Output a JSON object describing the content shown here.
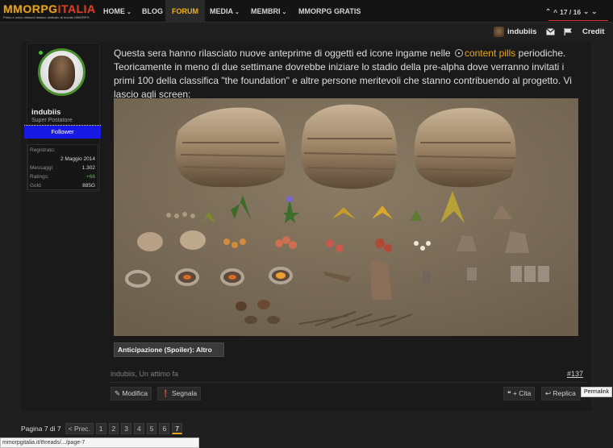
{
  "site": {
    "logo_main": "MMORPG",
    "logo_accent": "ITALIA",
    "logo_tagline": "Primo e unico network italiano dedicato al mondo MMORPG",
    "nav": [
      {
        "label": "HOME",
        "has_menu": true,
        "active": false
      },
      {
        "label": "BLOG",
        "has_menu": false,
        "active": false
      },
      {
        "label": "FORUM",
        "has_menu": false,
        "active": true
      },
      {
        "label": "MEDIA",
        "has_menu": true,
        "active": false
      },
      {
        "label": "MEMBRI",
        "has_menu": true,
        "active": false
      },
      {
        "label": "MMORPG GRATIS",
        "has_menu": false,
        "active": false
      }
    ],
    "thread_position": "17 / 16"
  },
  "userbar": {
    "username": "indubiis",
    "credit_label": "Credit",
    "icons": [
      "envelope-icon",
      "flag-icon"
    ]
  },
  "author": {
    "name": "indubiis",
    "title": "Super Postatore",
    "badge": "Follower",
    "stats": [
      {
        "label": "Registrato:",
        "value": ""
      },
      {
        "label": "",
        "value": "2 Maggio 2014"
      },
      {
        "label": "Messaggi:",
        "value": "1.302"
      },
      {
        "label": "Ratings:",
        "value": "+66"
      },
      {
        "label": "Gold",
        "value": "885G"
      }
    ],
    "ratings_color": "#4fc33a"
  },
  "post": {
    "text_before_link": "Questa sera hanno rilasciato nuove anteprime di oggetti ed icone ingame nelle ",
    "link_text": "content pills",
    "text_after_link": " periodiche. Teoricamente in meno di due settimane dovrebbe iniziare lo stadio della pre-alpha dove verranno invitati i primi 100 della classifica \"the foundation\" e altre persone meritevoli che stanno contribuendo al progetto. Vi lascio agli screen:",
    "spoiler_label": "Anticipazione (Spoiler): Altro",
    "meta": "indubiis, Un attimo fa",
    "number": "#137",
    "actions": {
      "edit": "Modifica",
      "report": "Segnala",
      "quote": "+ Cita",
      "reply": "Replica"
    },
    "tooltip": "Permalink",
    "accent_color": "#e9a51b"
  },
  "pagination": {
    "label": "Pagina 7 di 7",
    "prev": "< Prec.",
    "pages": [
      "1",
      "2",
      "3",
      "4",
      "5",
      "6",
      "7"
    ],
    "current": "7"
  },
  "statusbar": {
    "url": "mmorpgitalia.it/threads/.../page-7"
  }
}
